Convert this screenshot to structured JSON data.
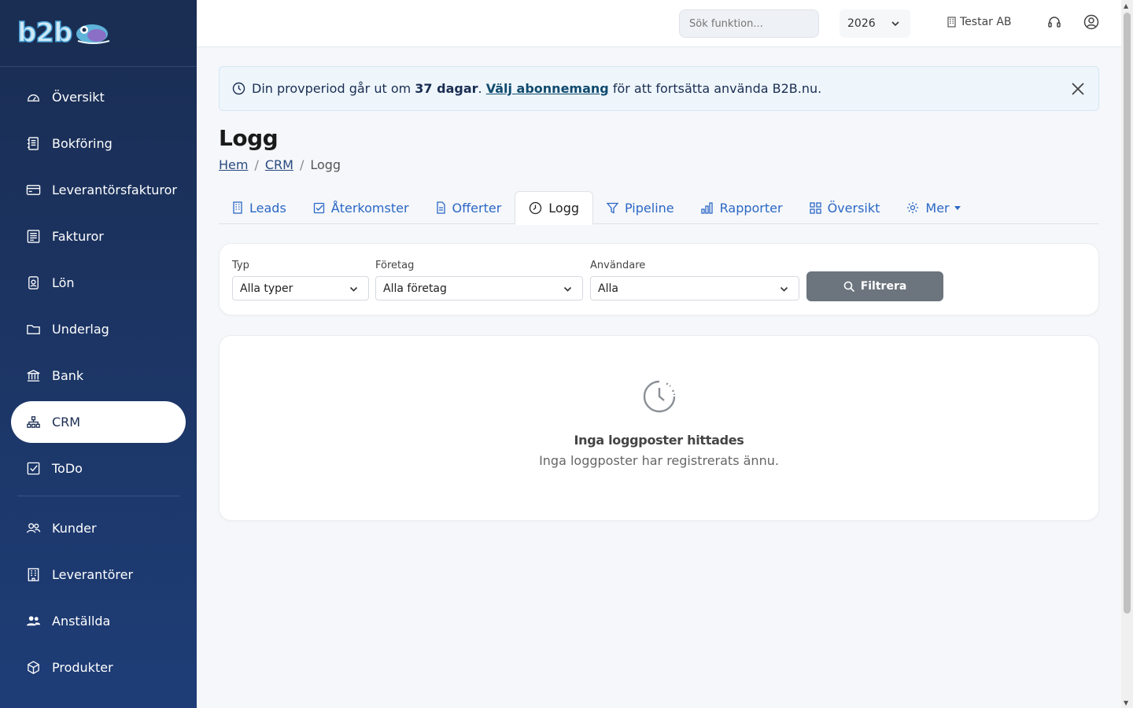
{
  "logo": {
    "text_b": "b2b"
  },
  "sidebar": {
    "items": [
      {
        "label": "Översikt",
        "icon": "gauge-icon"
      },
      {
        "label": "Bokföring",
        "icon": "journal-icon"
      },
      {
        "label": "Leverantörsfakturor",
        "icon": "credit-card-icon"
      },
      {
        "label": "Fakturor",
        "icon": "invoice-icon"
      },
      {
        "label": "Lön",
        "icon": "badge-icon"
      },
      {
        "label": "Underlag",
        "icon": "folder-icon"
      },
      {
        "label": "Bank",
        "icon": "bank-icon"
      },
      {
        "label": "CRM",
        "icon": "diagram-icon",
        "active": true
      },
      {
        "label": "ToDo",
        "icon": "check-square-icon"
      }
    ],
    "items2": [
      {
        "label": "Kunder",
        "icon": "users-icon"
      },
      {
        "label": "Leverantörer",
        "icon": "building-icon"
      },
      {
        "label": "Anställda",
        "icon": "people-icon"
      },
      {
        "label": "Produkter",
        "icon": "box-icon"
      }
    ]
  },
  "topbar": {
    "search_placeholder": "Sök funktion...",
    "year": "2026",
    "company": "Testar AB"
  },
  "alert": {
    "prefix": "Din provperiod går ut om",
    "days": "37 dagar",
    "dot": ".",
    "link": "Välj abonnemang",
    "suffix": "för att fortsätta använda B2B.nu."
  },
  "page": {
    "title": "Logg",
    "breadcrumb": [
      "Hem",
      "CRM",
      "Logg"
    ]
  },
  "tabs": [
    {
      "label": "Leads",
      "icon": "building-icon"
    },
    {
      "label": "Återkomster",
      "icon": "check-square-icon"
    },
    {
      "label": "Offerter",
      "icon": "file-icon"
    },
    {
      "label": "Logg",
      "icon": "clock-icon",
      "active": true
    },
    {
      "label": "Pipeline",
      "icon": "funnel-icon"
    },
    {
      "label": "Rapporter",
      "icon": "bar-chart-icon"
    },
    {
      "label": "Översikt",
      "icon": "grid-icon"
    },
    {
      "label": "Mer",
      "icon": "gear-icon"
    }
  ],
  "filters": {
    "typ_label": "Typ",
    "typ_value": "Alla typer",
    "foretag_label": "Företag",
    "foretag_value": "Alla företag",
    "anvandare_label": "Användare",
    "anvandare_value": "Alla",
    "button": "Filtrera"
  },
  "empty": {
    "title": "Inga loggposter hittades",
    "subtitle": "Inga loggposter har registrerats ännu."
  }
}
